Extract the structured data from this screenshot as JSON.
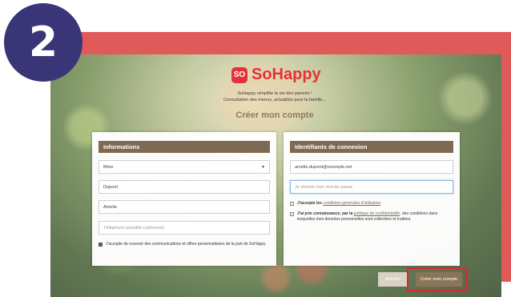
{
  "step": {
    "number": "2"
  },
  "brand": {
    "mark": "SO",
    "name": "SoHappy"
  },
  "tagline": {
    "line1": "SoHappy simplifie la vie des parents !",
    "line2": "Consultation des menus, actualités pour la famille..."
  },
  "page_title": "Créer mon compte",
  "informations": {
    "heading": "Informations",
    "civility": "Mme",
    "last_name": "Dupont",
    "first_name": "Amelie",
    "phone_placeholder": "Téléphone portable (optionnel)",
    "consent_label": "J'accepte de recevoir des communications et offres personnalisées de la part de SoHappy",
    "consent_checked": true
  },
  "identifiants": {
    "heading": "Identifiants de connexion",
    "email": "amelie.dupont@exemple.net",
    "password_placeholder": "Je choisis mon mot de passe",
    "cgu_prefix": "J'accepte les",
    "cgu_link": "conditions générales d'utilisation",
    "privacy_prefix": "J'ai pris connaissance, par la",
    "privacy_link": "politique de confidentialité",
    "privacy_suffix": ", des conditions dans lesquelles mes données personnelles sont collectées et traitées."
  },
  "actions": {
    "cancel_label": "Annuler",
    "create_label": "Créer mon compte"
  },
  "colors": {
    "frame": "#e05a5a",
    "badge": "#3a3577",
    "accent": "#7e6a52",
    "brand": "#e4323a",
    "highlight": "#d8282f"
  }
}
